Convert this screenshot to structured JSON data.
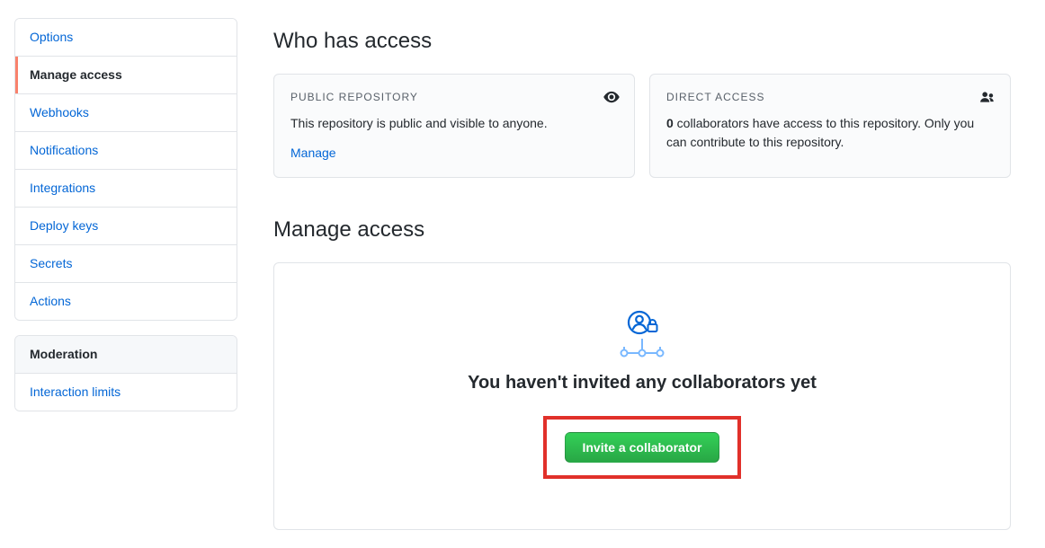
{
  "sidebar": {
    "items": [
      {
        "label": "Options"
      },
      {
        "label": "Manage access",
        "selected": true
      },
      {
        "label": "Webhooks"
      },
      {
        "label": "Notifications"
      },
      {
        "label": "Integrations"
      },
      {
        "label": "Deploy keys"
      },
      {
        "label": "Secrets"
      },
      {
        "label": "Actions"
      }
    ],
    "moderation_heading": "Moderation",
    "moderation_items": [
      {
        "label": "Interaction limits"
      }
    ]
  },
  "main": {
    "who_has_access_title": "Who has access",
    "public_card": {
      "heading": "PUBLIC REPOSITORY",
      "body": "This repository is public and visible to anyone.",
      "manage_link": "Manage"
    },
    "direct_card": {
      "heading": "DIRECT ACCESS",
      "count": "0",
      "body_after_count": " collaborators have access to this repository. Only you can contribute to this repository."
    },
    "manage_access_title": "Manage access",
    "empty_state": {
      "title": "You haven't invited any collaborators yet",
      "button": "Invite a collaborator"
    }
  }
}
